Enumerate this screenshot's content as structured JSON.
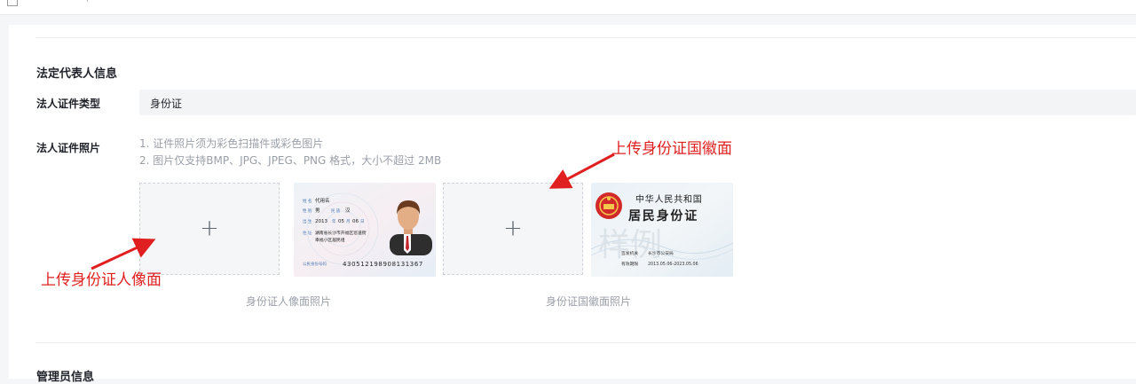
{
  "section": {
    "title": "法定代表人信息",
    "next_title": "管理员信息"
  },
  "id_type": {
    "label": "法人证件类型",
    "value": "身份证"
  },
  "id_photo": {
    "label": "法人证件照片",
    "hints": [
      "1. 证件照片须为彩色扫描件或彩色图片",
      "2. 图片仅支持BMP、JPG、JPEG、PNG 格式，大小不超过 2MB"
    ]
  },
  "uploads": {
    "front": {
      "caption": "身份证人像面照片",
      "annotation": "上传身份证人像面"
    },
    "back": {
      "caption": "身份证国徽面照片",
      "annotation": "上传身份证国徽面"
    }
  },
  "sample_front": {
    "label_name": "姓 名",
    "name": "代用名",
    "label_sex": "性 别",
    "sex": "男",
    "label_nation": "民 族",
    "nation": "汉",
    "label_birth": "出 生",
    "birth_year": "2013",
    "birth_month": "05",
    "birth_day": "06",
    "label_address": "住 址",
    "address_line1": "湖南省长沙市开福区巡道街",
    "address_line2": "幸福小区居民组",
    "label_id": "公民身份号码",
    "id_number": "430512198908131367"
  },
  "sample_back": {
    "country": "中华人民共和国",
    "card_name": "居民身份证",
    "label_authority": "签发机关",
    "authority": "长沙市公安局",
    "label_valid": "有效期限",
    "valid": "2013.05.06-2023.05.06",
    "watermark": "样例"
  },
  "colors": {
    "annotation": "#e02020",
    "page_bg": "#f5f6f8",
    "input_bg": "#f3f4f6"
  }
}
